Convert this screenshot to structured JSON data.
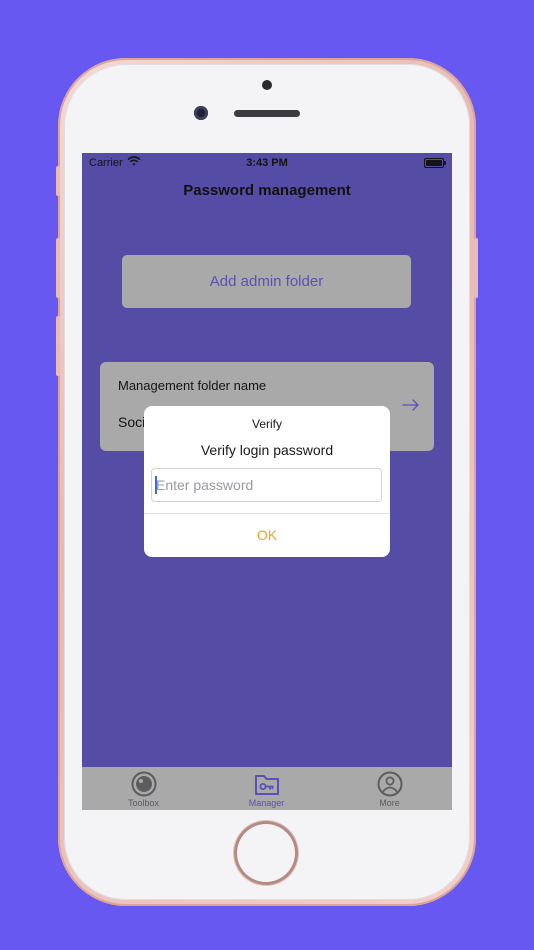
{
  "status_bar": {
    "carrier": "Carrier",
    "time": "3:43 PM"
  },
  "nav": {
    "title": "Password management"
  },
  "main": {
    "add_button_label": "Add admin folder",
    "folder_card": {
      "label": "Management folder name",
      "value_visible": "Soci"
    }
  },
  "alert": {
    "title": "Verify",
    "message": "Verify login password",
    "input_placeholder": "Enter password",
    "ok_label": "OK"
  },
  "tab_bar": {
    "items": [
      {
        "label": "Toolbox",
        "icon": "toolbox-icon",
        "active": false
      },
      {
        "label": "Manager",
        "icon": "folder-key-icon",
        "active": true
      },
      {
        "label": "More",
        "icon": "person-icon",
        "active": false
      }
    ]
  },
  "colors": {
    "background": "#6658f0",
    "screen": "#544ca5",
    "accent": "#5a52b2",
    "ok": "#f0a31d",
    "card": "#a9a9aa"
  }
}
